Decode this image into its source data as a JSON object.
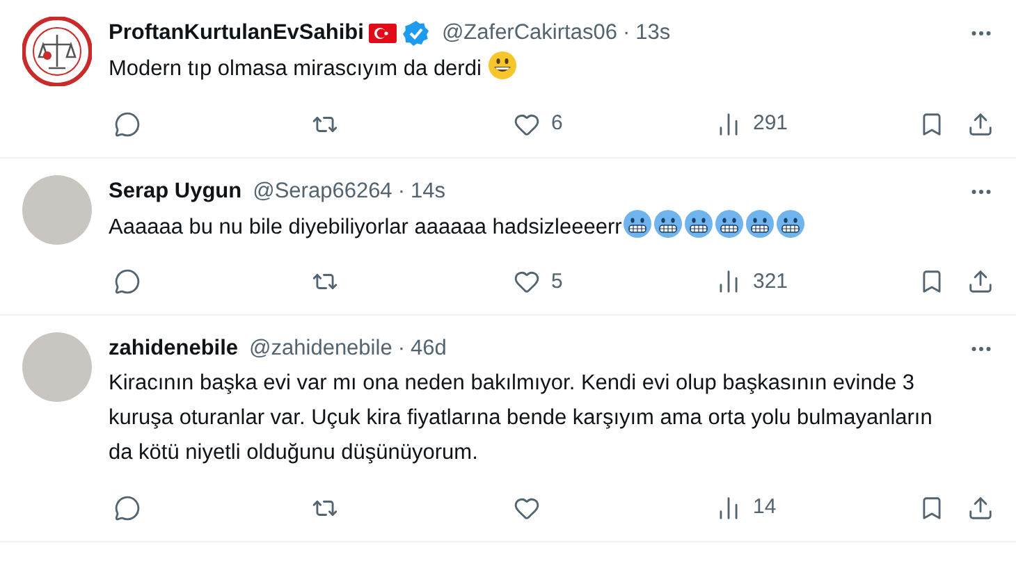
{
  "tweets": [
    {
      "avatar": {
        "kind": "logo"
      },
      "name": "ProftanKurtulanEvSahibi",
      "flag": true,
      "verified": true,
      "handle": "@ZaferCakirtas06",
      "separator": "·",
      "time": "13s",
      "text": "Modern tıp olmasa mirascıyım da derdi",
      "emojis": [
        {
          "kind": "grin"
        }
      ],
      "likes": "6",
      "views": "291"
    },
    {
      "avatar": {
        "kind": "photo"
      },
      "name": "Serap Uygun",
      "flag": false,
      "verified": false,
      "handle": "@Serap66264",
      "separator": "·",
      "time": "14s",
      "text": "Aaaaaa bu nu bile diyebiliyorlar aaaaaa hadsizleeeerr",
      "emojis": [
        {
          "kind": "cold"
        },
        {
          "kind": "cold"
        },
        {
          "kind": "cold"
        },
        {
          "kind": "cold"
        },
        {
          "kind": "cold"
        },
        {
          "kind": "cold"
        }
      ],
      "likes": "5",
      "views": "321"
    },
    {
      "avatar": {
        "kind": "photo"
      },
      "name": "zahidenebile",
      "flag": false,
      "verified": false,
      "handle": "@zahidenebile",
      "separator": "·",
      "time": "46d",
      "text": "Kiracının başka evi var mı ona neden bakılmıyor. Kendi evi olup başkasının evinde 3 kuruşa oturanlar var. Uçuk kira fiyatlarına bende karşıyım ama orta yolu bulmayanların da kötü niyetli olduğunu düşünüyorum.",
      "views": "14"
    }
  ]
}
